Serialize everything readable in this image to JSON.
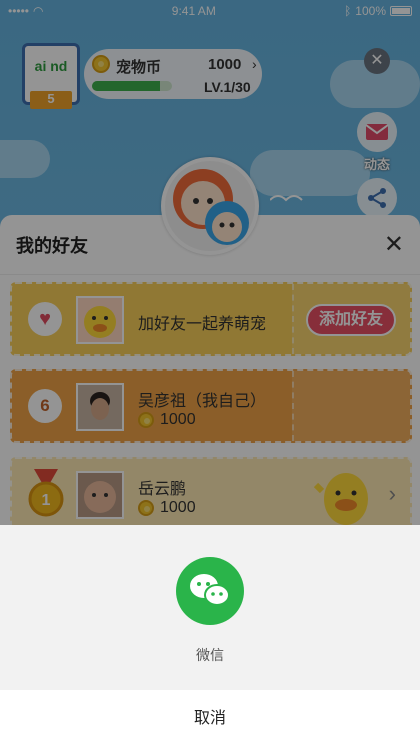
{
  "status_bar": {
    "time": "9:41 AM",
    "battery": "100%"
  },
  "pet_panel": {
    "logo_text": "ai nd",
    "level_badge": "5",
    "coin_label": "宠物币",
    "coin_value": "1000",
    "coin_arrow": "›",
    "level_text": "LV.1/30",
    "progress": 0.85
  },
  "side_buttons": {
    "close": "✕",
    "dynamic_label": "动态"
  },
  "friends": {
    "title": "我的好友",
    "close": "✕",
    "add_row": {
      "text": "加好友一起养萌宠",
      "button": "添加好友"
    },
    "me_row": {
      "rank": "6",
      "name": "吴彦祖（我自己）",
      "score": "1000"
    },
    "first_row": {
      "rank": "1",
      "name": "岳云鹏",
      "score": "1000",
      "chevron": "›"
    }
  },
  "share_sheet": {
    "option_label": "微信",
    "cancel": "取消"
  },
  "colors": {
    "wechat_green": "#2ab44a",
    "add_button": "#e85065",
    "card_yellow": "#f8cf5a",
    "card_orange": "#f0a347"
  }
}
